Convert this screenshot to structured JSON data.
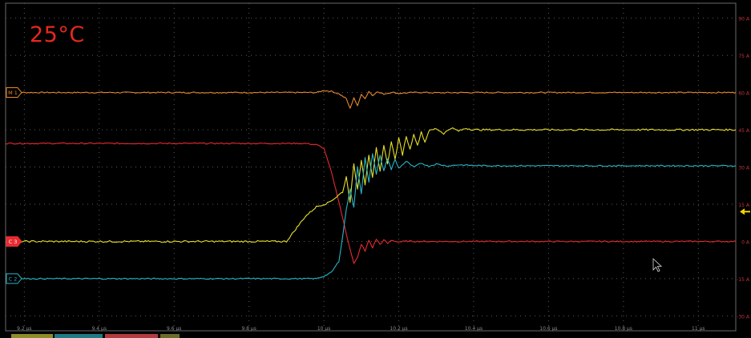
{
  "temperature_label": "25°C",
  "colors": {
    "background": "#000000",
    "grid": "#5a5a5a",
    "orange": "#e8892c",
    "red": "#e82a30",
    "yellow": "#e8e028",
    "cyan": "#25b7c8",
    "right_axis_text": "#c2343a",
    "bottom_axis_text": "#8a8a8a",
    "marker_arrow": "#f2d200"
  },
  "chart_data": {
    "type": "line",
    "title": "",
    "xlabel": "",
    "ylabel": "",
    "x_unit": "µs",
    "x_range": [
      9.15,
      11.1
    ],
    "y_range": [
      -36,
      96
    ],
    "grid": true,
    "x_ticks": [
      {
        "value": 9.2,
        "label": "9.2 µs"
      },
      {
        "value": 9.4,
        "label": "9.4 µs"
      },
      {
        "value": 9.6,
        "label": "9.6 µs"
      },
      {
        "value": 9.8,
        "label": "9.8 µs"
      },
      {
        "value": 10.0,
        "label": "10 µs"
      },
      {
        "value": 10.2,
        "label": "10.2 µs"
      },
      {
        "value": 10.4,
        "label": "10.4 µs"
      },
      {
        "value": 10.6,
        "label": "10.6 µs"
      },
      {
        "value": 10.8,
        "label": "10.8 µs"
      },
      {
        "value": 11.0,
        "label": "11 µs"
      }
    ],
    "y_ticks": [
      {
        "value": 90,
        "label": "90 A"
      },
      {
        "value": 75,
        "label": "75 A"
      },
      {
        "value": 60,
        "label": "60 A"
      },
      {
        "value": 45,
        "label": "45 A"
      },
      {
        "value": 30,
        "label": "30 A"
      },
      {
        "value": 15,
        "label": "15 A"
      },
      {
        "value": 0,
        "label": "0 A"
      },
      {
        "value": -15,
        "label": "-15 A"
      },
      {
        "value": -30,
        "label": "-30 A"
      }
    ],
    "channel_markers": [
      {
        "label": "M 1",
        "level": 60,
        "color": "orange"
      },
      {
        "label": "C 3",
        "level": 0,
        "color": "red"
      },
      {
        "label": "C 2",
        "level": -15,
        "color": "cyan"
      }
    ],
    "series": [
      {
        "color": "orange",
        "noise": 0.25,
        "x": [
          9.15,
          9.98,
          10.0,
          10.02,
          10.04,
          10.06,
          10.07,
          10.08,
          10.09,
          10.1,
          10.11,
          10.12,
          10.13,
          10.14,
          10.16,
          10.18,
          10.2,
          10.25,
          10.3,
          10.4,
          11.1
        ],
        "y": [
          60,
          60,
          60.8,
          60.5,
          59.5,
          57.5,
          53.5,
          58.0,
          54.5,
          59.5,
          57.5,
          60.5,
          58.8,
          60.3,
          59.4,
          60.1,
          59.7,
          60.1,
          59.9,
          60.0,
          60.0
        ]
      },
      {
        "color": "red",
        "noise": 0.25,
        "x": [
          9.15,
          9.95,
          9.98,
          10.0,
          10.02,
          10.04,
          10.06,
          10.08,
          10.09,
          10.1,
          10.11,
          10.12,
          10.13,
          10.14,
          10.15,
          10.16,
          10.17,
          10.18,
          10.2,
          10.22,
          10.25,
          10.3,
          11.1
        ],
        "y": [
          39.5,
          39.5,
          39.0,
          37.5,
          28.0,
          16.0,
          3.0,
          -9.0,
          -6.5,
          -1.0,
          -4.0,
          0.5,
          -2.5,
          1.0,
          -1.2,
          0.6,
          -0.8,
          0.4,
          -0.2,
          0.1,
          0.0,
          0.0,
          0.0
        ]
      },
      {
        "color": "yellow",
        "noise": 0.35,
        "x": [
          9.15,
          9.9,
          9.92,
          9.95,
          9.98,
          10.01,
          10.03,
          10.05,
          10.06,
          10.07,
          10.08,
          10.09,
          10.1,
          10.11,
          10.12,
          10.13,
          10.14,
          10.15,
          10.16,
          10.17,
          10.18,
          10.19,
          10.2,
          10.21,
          10.22,
          10.23,
          10.24,
          10.25,
          10.26,
          10.27,
          10.28,
          10.3,
          10.32,
          10.34,
          10.36,
          10.38,
          10.4,
          11.1
        ],
        "y": [
          0,
          0,
          4.0,
          10.0,
          14.0,
          15.5,
          17.5,
          20.0,
          26.0,
          16.0,
          31.0,
          21.0,
          33.0,
          23.0,
          35.0,
          25.5,
          37.5,
          28.0,
          39.0,
          31.0,
          40.5,
          33.0,
          41.5,
          35.0,
          42.5,
          37.0,
          43.5,
          38.5,
          44.2,
          40.0,
          44.5,
          45.5,
          43.5,
          45.8,
          44.5,
          45.6,
          45.0,
          45.0
        ]
      },
      {
        "color": "cyan",
        "noise": 0.25,
        "x": [
          9.15,
          9.98,
          10.0,
          10.02,
          10.04,
          10.05,
          10.06,
          10.07,
          10.08,
          10.09,
          10.1,
          10.11,
          10.12,
          10.13,
          10.14,
          10.15,
          10.16,
          10.17,
          10.18,
          10.19,
          10.2,
          10.22,
          10.24,
          10.26,
          10.28,
          10.3,
          10.33,
          10.36,
          10.4,
          10.45,
          11.1
        ],
        "y": [
          -15.0,
          -15.0,
          -14.0,
          -12.5,
          -8.0,
          2.0,
          13.0,
          21.0,
          14.0,
          30.0,
          19.0,
          34.0,
          24.0,
          35.5,
          27.0,
          34.5,
          28.5,
          33.5,
          29.0,
          33.0,
          29.5,
          32.3,
          29.9,
          31.6,
          30.3,
          31.2,
          30.4,
          30.9,
          30.6,
          30.5,
          30.5
        ]
      }
    ]
  }
}
